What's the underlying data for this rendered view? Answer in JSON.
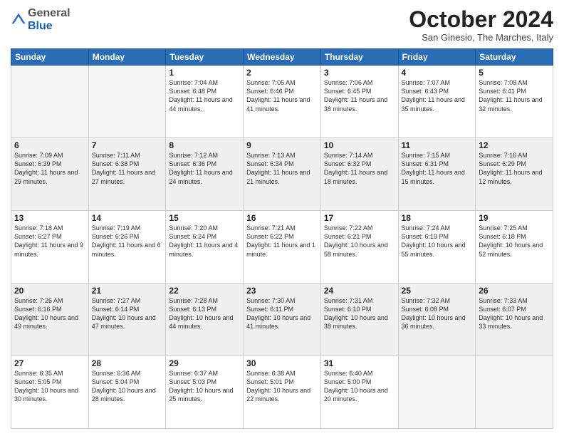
{
  "header": {
    "logo_line1": "General",
    "logo_line2": "Blue",
    "month": "October 2024",
    "location": "San Ginesio, The Marches, Italy"
  },
  "weekdays": [
    "Sunday",
    "Monday",
    "Tuesday",
    "Wednesday",
    "Thursday",
    "Friday",
    "Saturday"
  ],
  "weeks": [
    [
      {
        "day": "",
        "sunrise": "",
        "sunset": "",
        "daylight": "",
        "empty": true
      },
      {
        "day": "",
        "sunrise": "",
        "sunset": "",
        "daylight": "",
        "empty": true
      },
      {
        "day": "1",
        "sunrise": "Sunrise: 7:04 AM",
        "sunset": "Sunset: 6:48 PM",
        "daylight": "Daylight: 11 hours and 44 minutes.",
        "empty": false
      },
      {
        "day": "2",
        "sunrise": "Sunrise: 7:05 AM",
        "sunset": "Sunset: 6:46 PM",
        "daylight": "Daylight: 11 hours and 41 minutes.",
        "empty": false
      },
      {
        "day": "3",
        "sunrise": "Sunrise: 7:06 AM",
        "sunset": "Sunset: 6:45 PM",
        "daylight": "Daylight: 11 hours and 38 minutes.",
        "empty": false
      },
      {
        "day": "4",
        "sunrise": "Sunrise: 7:07 AM",
        "sunset": "Sunset: 6:43 PM",
        "daylight": "Daylight: 11 hours and 35 minutes.",
        "empty": false
      },
      {
        "day": "5",
        "sunrise": "Sunrise: 7:08 AM",
        "sunset": "Sunset: 6:41 PM",
        "daylight": "Daylight: 11 hours and 32 minutes.",
        "empty": false
      }
    ],
    [
      {
        "day": "6",
        "sunrise": "Sunrise: 7:09 AM",
        "sunset": "Sunset: 6:39 PM",
        "daylight": "Daylight: 11 hours and 29 minutes.",
        "empty": false
      },
      {
        "day": "7",
        "sunrise": "Sunrise: 7:11 AM",
        "sunset": "Sunset: 6:38 PM",
        "daylight": "Daylight: 11 hours and 27 minutes.",
        "empty": false
      },
      {
        "day": "8",
        "sunrise": "Sunrise: 7:12 AM",
        "sunset": "Sunset: 6:36 PM",
        "daylight": "Daylight: 11 hours and 24 minutes.",
        "empty": false
      },
      {
        "day": "9",
        "sunrise": "Sunrise: 7:13 AM",
        "sunset": "Sunset: 6:34 PM",
        "daylight": "Daylight: 11 hours and 21 minutes.",
        "empty": false
      },
      {
        "day": "10",
        "sunrise": "Sunrise: 7:14 AM",
        "sunset": "Sunset: 6:32 PM",
        "daylight": "Daylight: 11 hours and 18 minutes.",
        "empty": false
      },
      {
        "day": "11",
        "sunrise": "Sunrise: 7:15 AM",
        "sunset": "Sunset: 6:31 PM",
        "daylight": "Daylight: 11 hours and 15 minutes.",
        "empty": false
      },
      {
        "day": "12",
        "sunrise": "Sunrise: 7:16 AM",
        "sunset": "Sunset: 6:29 PM",
        "daylight": "Daylight: 11 hours and 12 minutes.",
        "empty": false
      }
    ],
    [
      {
        "day": "13",
        "sunrise": "Sunrise: 7:18 AM",
        "sunset": "Sunset: 6:27 PM",
        "daylight": "Daylight: 11 hours and 9 minutes.",
        "empty": false
      },
      {
        "day": "14",
        "sunrise": "Sunrise: 7:19 AM",
        "sunset": "Sunset: 6:26 PM",
        "daylight": "Daylight: 11 hours and 6 minutes.",
        "empty": false
      },
      {
        "day": "15",
        "sunrise": "Sunrise: 7:20 AM",
        "sunset": "Sunset: 6:24 PM",
        "daylight": "Daylight: 11 hours and 4 minutes.",
        "empty": false
      },
      {
        "day": "16",
        "sunrise": "Sunrise: 7:21 AM",
        "sunset": "Sunset: 6:22 PM",
        "daylight": "Daylight: 11 hours and 1 minute.",
        "empty": false
      },
      {
        "day": "17",
        "sunrise": "Sunrise: 7:22 AM",
        "sunset": "Sunset: 6:21 PM",
        "daylight": "Daylight: 10 hours and 58 minutes.",
        "empty": false
      },
      {
        "day": "18",
        "sunrise": "Sunrise: 7:24 AM",
        "sunset": "Sunset: 6:19 PM",
        "daylight": "Daylight: 10 hours and 55 minutes.",
        "empty": false
      },
      {
        "day": "19",
        "sunrise": "Sunrise: 7:25 AM",
        "sunset": "Sunset: 6:18 PM",
        "daylight": "Daylight: 10 hours and 52 minutes.",
        "empty": false
      }
    ],
    [
      {
        "day": "20",
        "sunrise": "Sunrise: 7:26 AM",
        "sunset": "Sunset: 6:16 PM",
        "daylight": "Daylight: 10 hours and 49 minutes.",
        "empty": false
      },
      {
        "day": "21",
        "sunrise": "Sunrise: 7:27 AM",
        "sunset": "Sunset: 6:14 PM",
        "daylight": "Daylight: 10 hours and 47 minutes.",
        "empty": false
      },
      {
        "day": "22",
        "sunrise": "Sunrise: 7:28 AM",
        "sunset": "Sunset: 6:13 PM",
        "daylight": "Daylight: 10 hours and 44 minutes.",
        "empty": false
      },
      {
        "day": "23",
        "sunrise": "Sunrise: 7:30 AM",
        "sunset": "Sunset: 6:11 PM",
        "daylight": "Daylight: 10 hours and 41 minutes.",
        "empty": false
      },
      {
        "day": "24",
        "sunrise": "Sunrise: 7:31 AM",
        "sunset": "Sunset: 6:10 PM",
        "daylight": "Daylight: 10 hours and 38 minutes.",
        "empty": false
      },
      {
        "day": "25",
        "sunrise": "Sunrise: 7:32 AM",
        "sunset": "Sunset: 6:08 PM",
        "daylight": "Daylight: 10 hours and 36 minutes.",
        "empty": false
      },
      {
        "day": "26",
        "sunrise": "Sunrise: 7:33 AM",
        "sunset": "Sunset: 6:07 PM",
        "daylight": "Daylight: 10 hours and 33 minutes.",
        "empty": false
      }
    ],
    [
      {
        "day": "27",
        "sunrise": "Sunrise: 6:35 AM",
        "sunset": "Sunset: 5:05 PM",
        "daylight": "Daylight: 10 hours and 30 minutes.",
        "empty": false
      },
      {
        "day": "28",
        "sunrise": "Sunrise: 6:36 AM",
        "sunset": "Sunset: 5:04 PM",
        "daylight": "Daylight: 10 hours and 28 minutes.",
        "empty": false
      },
      {
        "day": "29",
        "sunrise": "Sunrise: 6:37 AM",
        "sunset": "Sunset: 5:03 PM",
        "daylight": "Daylight: 10 hours and 25 minutes.",
        "empty": false
      },
      {
        "day": "30",
        "sunrise": "Sunrise: 6:38 AM",
        "sunset": "Sunset: 5:01 PM",
        "daylight": "Daylight: 10 hours and 22 minutes.",
        "empty": false
      },
      {
        "day": "31",
        "sunrise": "Sunrise: 6:40 AM",
        "sunset": "Sunset: 5:00 PM",
        "daylight": "Daylight: 10 hours and 20 minutes.",
        "empty": false
      },
      {
        "day": "",
        "sunrise": "",
        "sunset": "",
        "daylight": "",
        "empty": true
      },
      {
        "day": "",
        "sunrise": "",
        "sunset": "",
        "daylight": "",
        "empty": true
      }
    ]
  ]
}
